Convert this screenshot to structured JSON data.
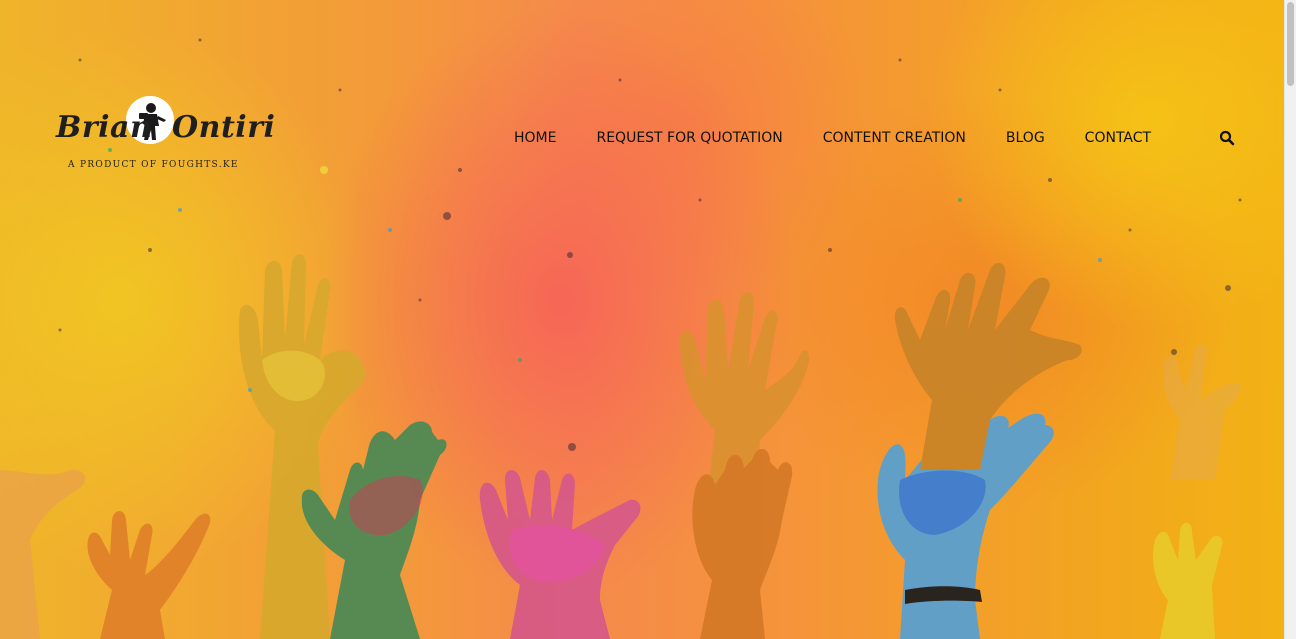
{
  "header": {
    "logo": {
      "first_name": "Brian",
      "last_name": "Ontiri",
      "tagline": "A PRODUCT OF FOUGHTS.KE",
      "badge_icon": "photographer-icon"
    },
    "nav": {
      "items": [
        {
          "label": "HOME"
        },
        {
          "label": "REQUEST FOR QUOTATION"
        },
        {
          "label": "CONTENT CREATION"
        },
        {
          "label": "BLOG"
        },
        {
          "label": "CONTACT"
        }
      ]
    },
    "search_icon": "search-icon"
  },
  "hero": {
    "image": "colorful-powder-raised-hands-photo"
  },
  "colors": {
    "nav_text": "#111111",
    "hero_orange": "#f39a39",
    "hero_pink": "#f66058",
    "hero_yellow": "#f1c622"
  }
}
